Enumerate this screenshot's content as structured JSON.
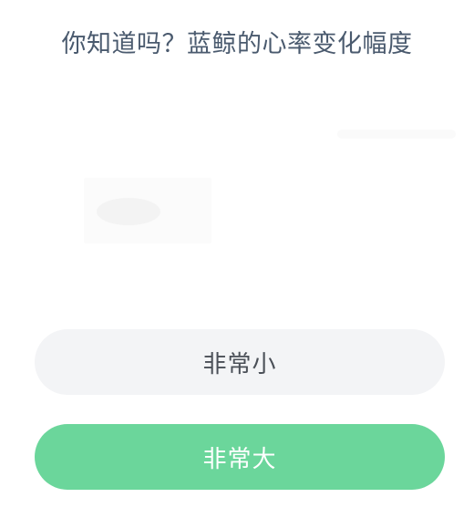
{
  "question": {
    "text": "你知道吗？蓝鲸的心率变化幅度"
  },
  "options": [
    {
      "label": "非常小",
      "selected": false
    },
    {
      "label": "非常大",
      "selected": true
    }
  ],
  "colors": {
    "question_text": "#4a5a6e",
    "option_default_bg": "#f3f4f6",
    "option_default_text": "#4a4f57",
    "option_selected_bg": "#6bd69b",
    "option_selected_text": "#ffffff"
  }
}
